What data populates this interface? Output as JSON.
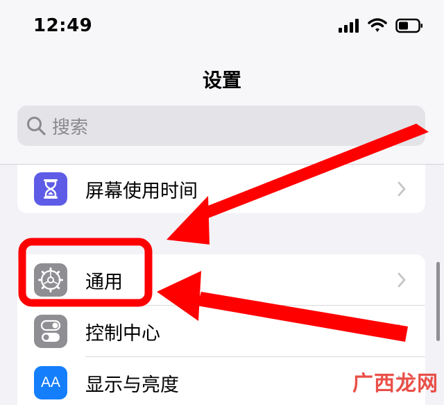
{
  "status_bar": {
    "time": "12:49"
  },
  "nav": {
    "title": "设置"
  },
  "search": {
    "placeholder": "搜索"
  },
  "settings": {
    "screen_time": "屏幕使用时间",
    "general": "通用",
    "control_center": "控制中心",
    "display_brightness": "显示与亮度",
    "display_icon_text": "AA"
  },
  "watermark": "广西龙网",
  "colors": {
    "screen_time_icon": "#5e5ce6",
    "general_icon": "#8e8e93",
    "control_center_icon": "#8e8e93",
    "display_icon": "#147efb",
    "annotation": "#ff0000"
  }
}
